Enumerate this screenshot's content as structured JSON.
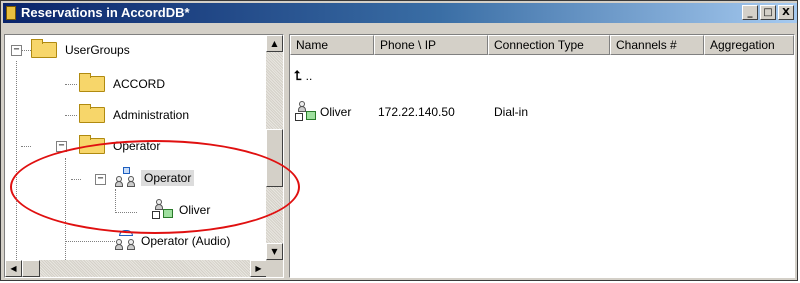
{
  "window": {
    "title": "Reservations in AccordDB*",
    "caption_buttons": [
      "_",
      "□",
      "X"
    ],
    "icon": "database-icon"
  },
  "tree": {
    "items": [
      {
        "label": "UserGroups",
        "icon": "folder-icon",
        "expander": "−"
      },
      {
        "label": "ACCORD",
        "icon": "folder-icon"
      },
      {
        "label": "Administration",
        "icon": "folder-icon"
      },
      {
        "label": "Operator",
        "icon": "folder-icon",
        "expander": "−"
      },
      {
        "label": "Operator",
        "icon": "operator-group-icon",
        "expander": "−",
        "selected": true
      },
      {
        "label": "Oliver",
        "icon": "participant-icon"
      },
      {
        "label": "Operator (Audio)",
        "icon": "audio-operator-icon"
      }
    ]
  },
  "list": {
    "columns": [
      "Name",
      "Phone \\ IP",
      "Connection Type",
      "Channels #",
      "Aggregation"
    ],
    "up_label": "..",
    "rows": [
      {
        "name": "Oliver",
        "phone_ip": "172.22.140.50",
        "connection_type": "Dial-in",
        "channels": "",
        "aggregation": ""
      }
    ]
  },
  "annotation": {
    "color": "#e01010"
  }
}
